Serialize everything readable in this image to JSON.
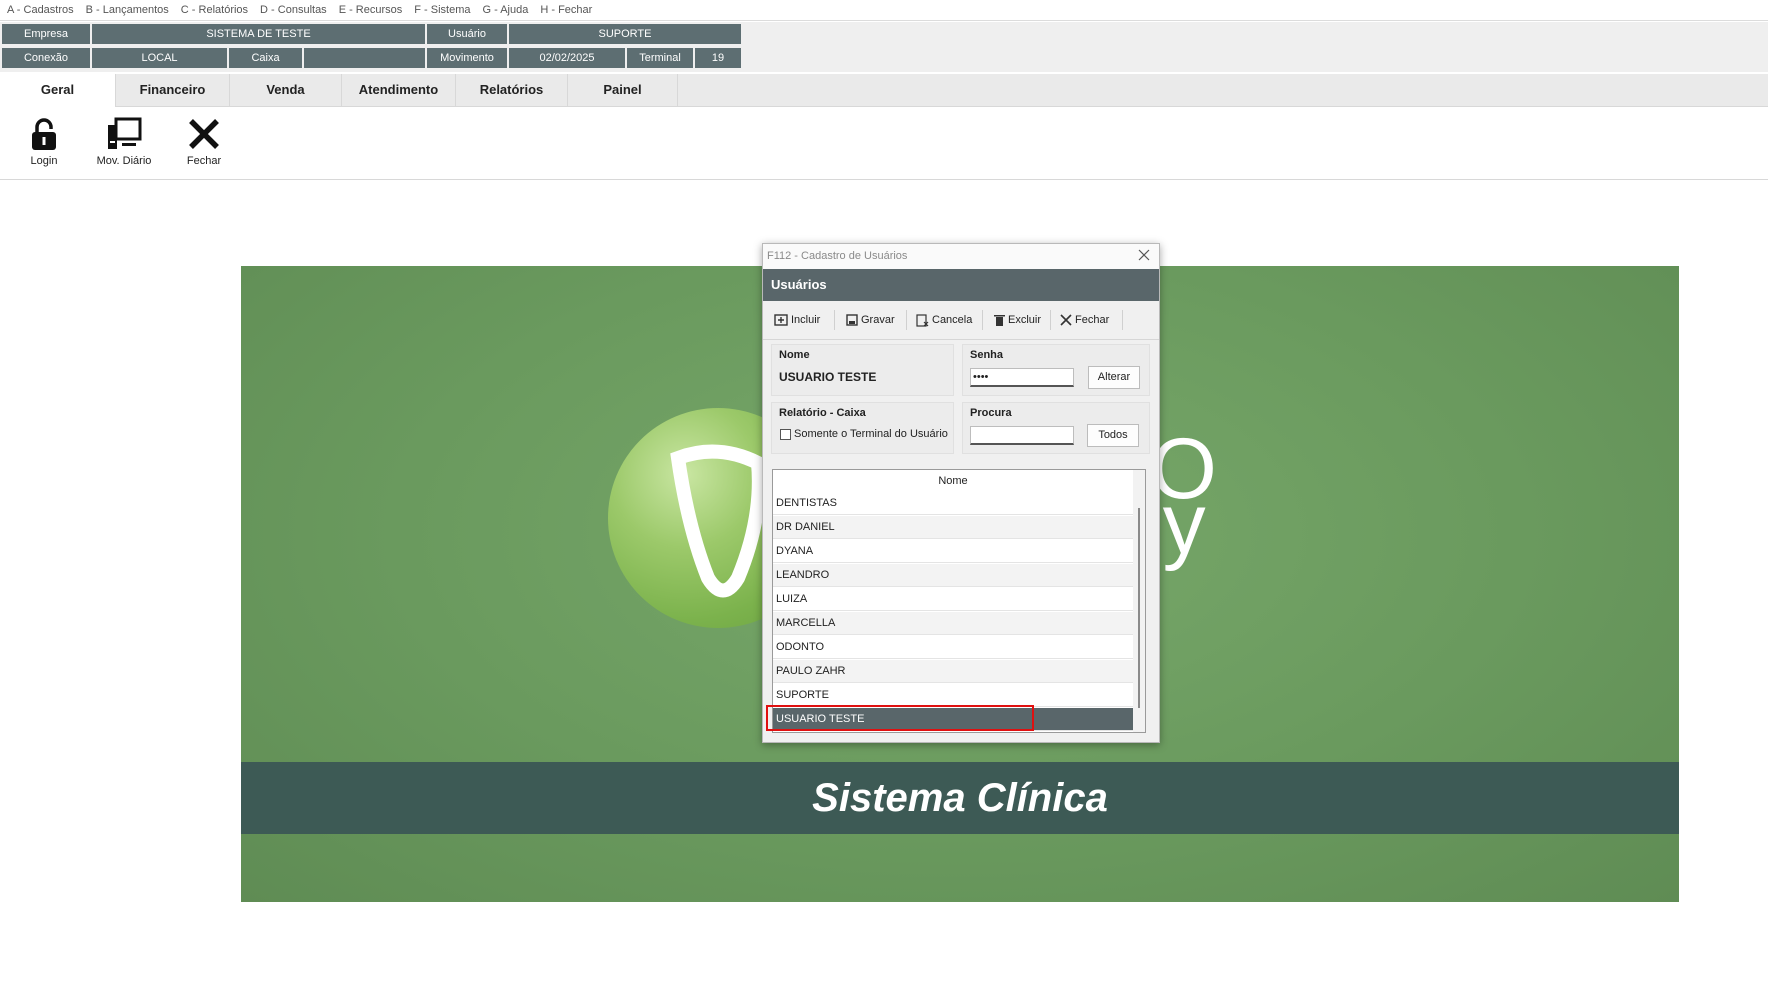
{
  "menu": [
    "A - Cadastros",
    "B - Lançamentos",
    "C - Relatórios",
    "D - Consultas",
    "E - Recursos",
    "F - Sistema",
    "G - Ajuda",
    "H - Fechar"
  ],
  "info": {
    "empresa_label": "Empresa",
    "empresa_value": "SISTEMA DE TESTE",
    "usuario_label": "Usuário",
    "usuario_value": "SUPORTE",
    "conexao_label": "Conexão",
    "conexao_value": "LOCAL",
    "caixa_label": "Caixa",
    "caixa_value": "",
    "movimento_label": "Movimento",
    "movimento_value": "02/02/2025",
    "terminal_label": "Terminal",
    "terminal_value": "19"
  },
  "tabs": [
    "Geral",
    "Financeiro",
    "Venda",
    "Atendimento",
    "Relatórios",
    "Painel"
  ],
  "active_tab": "Geral",
  "toolbar": {
    "login_label": "Login",
    "mov_diario_label": "Mov. Diário",
    "fechar_label": "Fechar"
  },
  "banner": {
    "logo_text_top": "TO",
    "logo_text_bottom": "any",
    "caption": "Sistema Clínica"
  },
  "dialog": {
    "title": "F112 - Cadastro de Usuários",
    "header": "Usuários",
    "buttons": {
      "incluir": "Incluir",
      "gravar": "Gravar",
      "cancela": "Cancela",
      "excluir": "Excluir",
      "fechar": "Fechar"
    },
    "nome_label": "Nome",
    "nome_value": "USUARIO TESTE",
    "senha_label": "Senha",
    "senha_value": "••••",
    "alterar_label": "Alterar",
    "relatorio_label": "Relatório - Caixa",
    "checkbox_label": "Somente o Terminal do Usuário",
    "checkbox_checked": false,
    "procura_label": "Procura",
    "procura_value": "",
    "todos_label": "Todos",
    "grid_header": "Nome",
    "rows": [
      "DENTISTAS",
      "DR DANIEL",
      "DYANA",
      "LEANDRO",
      "LUIZA",
      "MARCELLA",
      "ODONTO",
      "PAULO ZAHR",
      "SUPORTE",
      "USUARIO TESTE"
    ],
    "selected_row": "USUARIO TESTE"
  },
  "colors": {
    "bar": "#5d6e72",
    "banner_green": "#6a9a5e",
    "banner_strip": "#3d5a55",
    "selection": "#59666a",
    "highlight": "#e01010"
  }
}
